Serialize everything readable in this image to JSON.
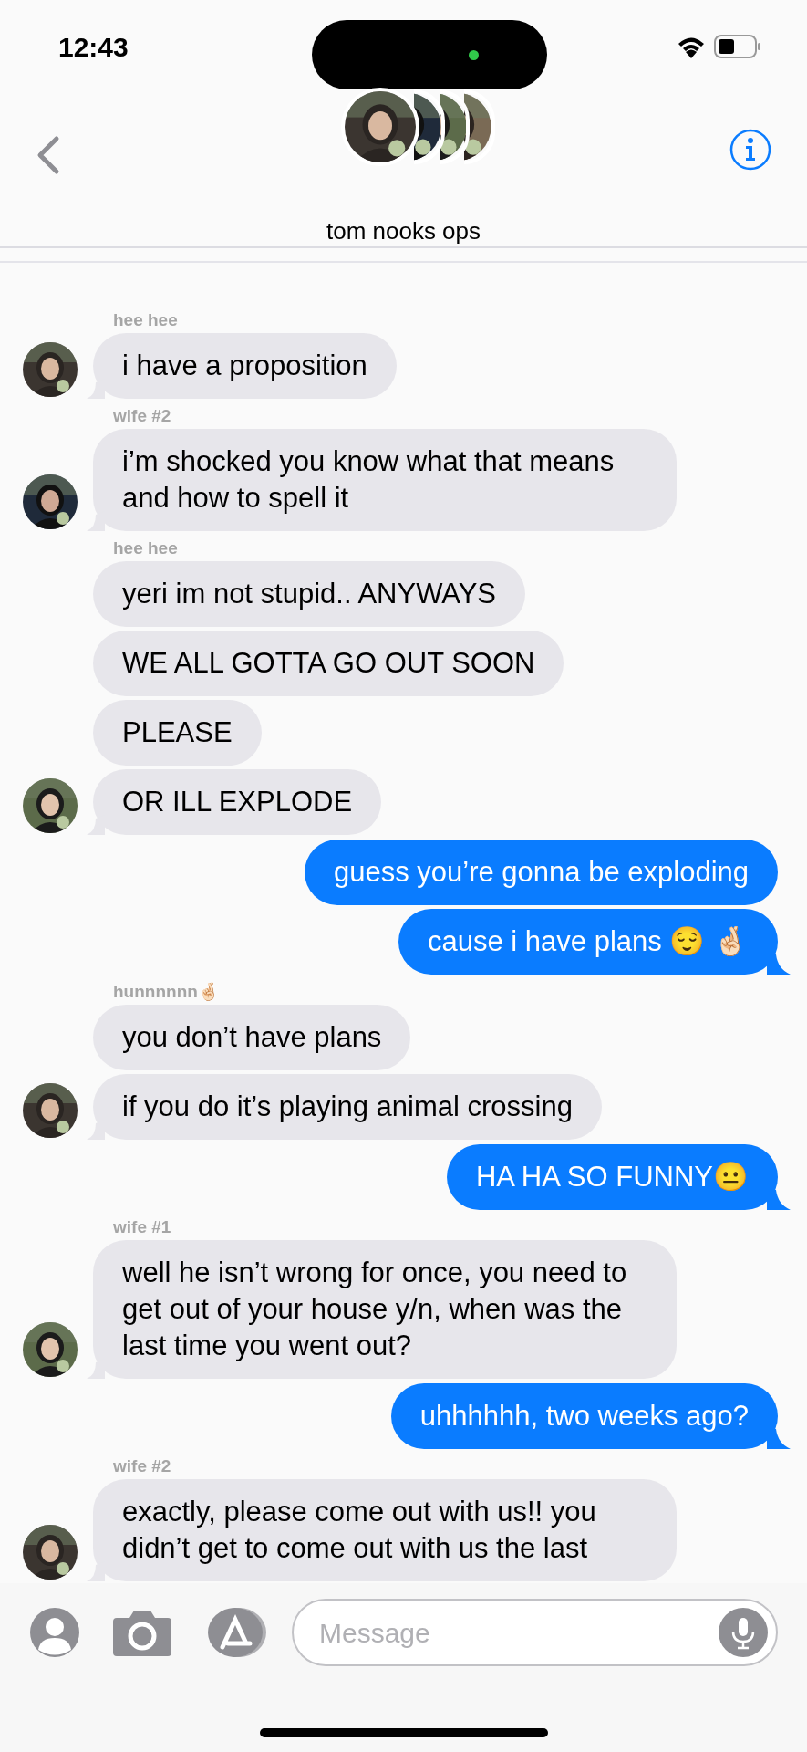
{
  "status_bar": {
    "time": "12:43"
  },
  "header": {
    "group_name": "tom nooks ops"
  },
  "messages": [
    {
      "kind": "received",
      "sender": "hee hee",
      "texts": [
        "i have a proposition"
      ]
    },
    {
      "kind": "received",
      "sender": "wife #2",
      "texts": [
        "i’m shocked you know what that means and how to spell it"
      ]
    },
    {
      "kind": "received",
      "sender": "hee hee",
      "texts": [
        "yeri im not stupid.. ANYWAYS",
        "WE ALL GOTTA GO OUT SOON",
        "PLEASE",
        "OR ILL EXPLODE"
      ]
    },
    {
      "kind": "sent",
      "texts": [
        "guess you’re gonna be exploding",
        "cause i have plans 😌 🤞🏻"
      ]
    },
    {
      "kind": "received",
      "sender": "hunnnnnn🤞🏻",
      "texts": [
        "you don’t have plans",
        "if you do it’s playing animal crossing"
      ]
    },
    {
      "kind": "sent",
      "texts": [
        "HA HA SO FUNNY😐"
      ]
    },
    {
      "kind": "received",
      "sender": "wife #1",
      "texts": [
        "well he isn’t wrong for once, you need to get out of your house y/n, when was the last time you went out?"
      ]
    },
    {
      "kind": "sent",
      "texts": [
        "uhhhhhh, two weeks ago?"
      ]
    },
    {
      "kind": "received",
      "sender": "wife #2",
      "texts": [
        "exactly, please come out with us!! you didn’t get to come out with us the last"
      ]
    }
  ],
  "composer": {
    "placeholder": "Message"
  }
}
